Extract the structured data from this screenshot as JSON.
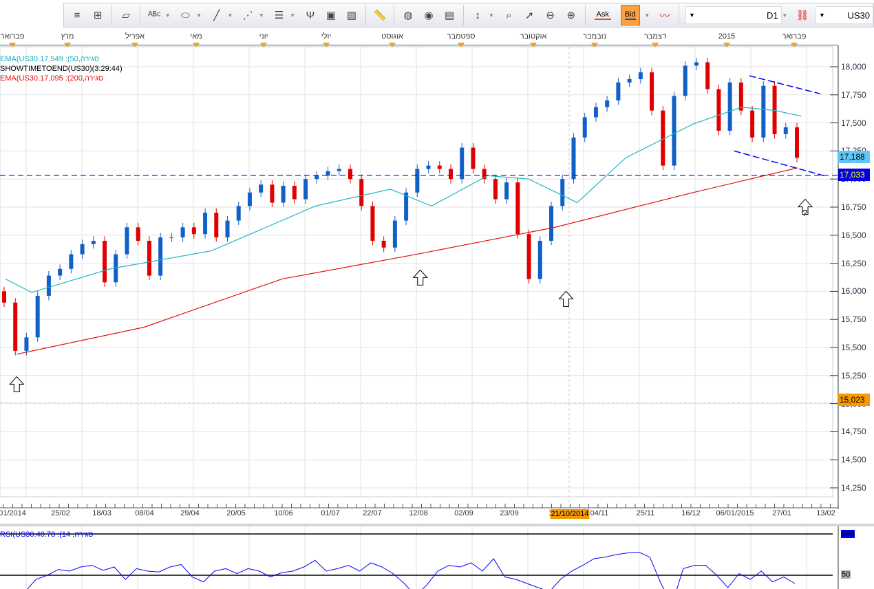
{
  "toolbar": {
    "items": [
      "menu-icon",
      "hierarchy-icon",
      "eraser-icon",
      "text-abc-icon",
      "ellipse-icon",
      "line-icon",
      "fan-icon",
      "fibonacci-icon",
      "pitchfork-icon",
      "window-chart-icon",
      "picture-icon",
      "ruler-icon",
      "globe-icon",
      "eye-icon",
      "properties-icon",
      "vertical-resize-icon",
      "zoom-box-icon",
      "zoom-pointer-icon",
      "zoom-out-icon",
      "zoom-in-icon"
    ],
    "ask": "Ask",
    "bid": "Bid",
    "timeframe": "D1",
    "symbol": "US30"
  },
  "months": [
    "פברואר",
    "מרץ",
    "אפריל",
    "מאי",
    "יוני",
    "יולי",
    "אוגוסט",
    "ספטמבר",
    "אוקטובר",
    "נובמבר",
    "דצמבר",
    "2015",
    "פברואר"
  ],
  "legend": {
    "ema50": "EMA(US30.17,549 :(50,סגירה",
    "showtime": "SHOWTIMETOEND(US30)(3:29:44)",
    "ema200": "EMA(US30.17,095 :(200,סגירה",
    "rsi": "RSI(US30.40.78 :(14 ,סגירה"
  },
  "dates": [
    "01/2014",
    "25/02",
    "18/03",
    "08/04",
    "29/04",
    "20/05",
    "10/06",
    "01/07",
    "22/07",
    "12/08",
    "02/09",
    "23/09",
    "1",
    "21/10/2014",
    "04/11",
    "25/11",
    "16/12",
    "06/01/2015",
    "27/01",
    "13/02"
  ],
  "price_labels": {
    "last": "17,188",
    "line": "17,033",
    "cursor": "15,023"
  },
  "rsi_labels": {
    "top": "100",
    "mid": "50"
  },
  "question": "?",
  "colors": {
    "up": "#1060c8",
    "down": "#e00000",
    "ema50": "#20b8c0",
    "ema200": "#e01010",
    "line": "#0000ff",
    "rsi": "#0000ff"
  },
  "chart_data": {
    "type": "candlestick",
    "ylim": [
      14100,
      18200
    ],
    "yticks": [
      14250,
      14500,
      14750,
      15000,
      15250,
      15500,
      15750,
      16000,
      16250,
      16500,
      16750,
      17000,
      17250,
      17500,
      17750,
      18000
    ],
    "closes": [
      15900,
      15470,
      15590,
      15960,
      16140,
      16200,
      16330,
      16420,
      16450,
      16080,
      16330,
      16570,
      16450,
      16140,
      16480,
      16480,
      16570,
      16510,
      16700,
      16480,
      16630,
      16760,
      16880,
      16950,
      16790,
      16940,
      16820,
      17000,
      17030,
      17070,
      17090,
      17000,
      16760,
      16450,
      16390,
      16630,
      16880,
      17090,
      17120,
      17090,
      17000,
      17280,
      17090,
      17000,
      16820,
      16970,
      16510,
      16110,
      16450,
      16760,
      17000,
      17370,
      17550,
      17640,
      17700,
      17860,
      17890,
      17950,
      17610,
      17120,
      17740,
      18010,
      18040,
      17800,
      17430,
      17860,
      17610,
      17370,
      17830,
      17400,
      17460,
      17190
    ],
    "ema200": [
      [
        3,
        15440
      ],
      [
        37,
        15680
      ],
      [
        74,
        16110
      ],
      [
        110,
        16330
      ],
      [
        147,
        16570
      ],
      [
        184,
        16880
      ],
      [
        212,
        17100
      ]
    ],
    "ema50": [
      [
        0,
        16110
      ],
      [
        7,
        15990
      ],
      [
        28,
        16200
      ],
      [
        55,
        16360
      ],
      [
        83,
        16760
      ],
      [
        103,
        16910
      ],
      [
        114,
        16760
      ],
      [
        129,
        17030
      ],
      [
        140,
        17000
      ],
      [
        153,
        16790
      ],
      [
        166,
        17190
      ],
      [
        184,
        17490
      ],
      [
        197,
        17640
      ],
      [
        206,
        17610
      ],
      [
        213,
        17560
      ]
    ],
    "hline": 17033,
    "channel_upper": [
      [
        199,
        17920
      ],
      [
        218,
        17760
      ]
    ],
    "channel_lower": [
      [
        195,
        17250
      ],
      [
        219,
        17030
      ]
    ],
    "arrows": [
      [
        3,
        15240
      ],
      [
        111,
        16190
      ],
      [
        150,
        16000
      ],
      [
        214,
        16820
      ]
    ],
    "rsi": [
      25,
      30,
      45,
      50,
      57,
      55,
      60,
      62,
      56,
      60,
      45,
      58,
      55,
      54,
      60,
      63,
      48,
      42,
      55,
      58,
      52,
      58,
      55,
      48,
      53,
      55,
      60,
      68,
      55,
      58,
      62,
      55,
      65,
      60,
      52,
      40,
      25,
      38,
      55,
      62,
      60,
      65,
      55,
      70,
      48,
      45,
      40,
      35,
      30,
      45,
      55,
      62,
      70,
      72,
      75,
      77,
      78,
      72,
      40,
      15,
      58,
      62,
      62,
      50,
      35,
      52,
      45,
      55,
      42,
      48,
      40
    ]
  }
}
